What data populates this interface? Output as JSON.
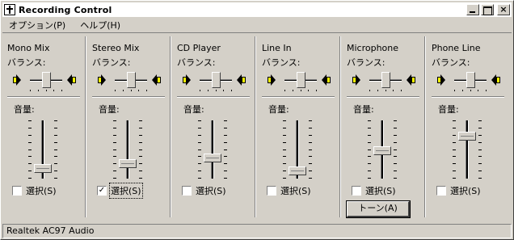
{
  "window": {
    "title": "Recording Control",
    "minimize_icon": "minimize-icon",
    "maximize_icon": "maximize-icon",
    "close_label": "×"
  },
  "menu": {
    "options": "オプション(P)",
    "help": "ヘルプ(H)"
  },
  "labels": {
    "balance": "バランス:",
    "volume": "音量:",
    "select": "選択(S)",
    "check_mark": "✓"
  },
  "channels": [
    {
      "name": "Mono Mix",
      "balance": 0.5,
      "volume": 0.1,
      "selected": false,
      "focused": false,
      "has_tone": false
    },
    {
      "name": "Stereo Mix",
      "balance": 0.5,
      "volume": 0.2,
      "selected": true,
      "focused": true,
      "has_tone": false
    },
    {
      "name": "CD Player",
      "balance": 0.5,
      "volume": 0.3,
      "selected": false,
      "focused": false,
      "has_tone": false
    },
    {
      "name": "Line In",
      "balance": 0.5,
      "volume": 0.05,
      "selected": false,
      "focused": false,
      "has_tone": false
    },
    {
      "name": "Microphone",
      "balance": 0.5,
      "volume": 0.45,
      "selected": false,
      "focused": false,
      "has_tone": true,
      "tone_label": "トーン(A)"
    },
    {
      "name": "Phone Line",
      "balance": 0.5,
      "volume": 0.75,
      "selected": false,
      "focused": false,
      "has_tone": false
    }
  ],
  "status": {
    "device": "Realtek AC97 Audio"
  },
  "colors": {
    "face": "#d4d0c8",
    "speaker": "#ffff00"
  }
}
